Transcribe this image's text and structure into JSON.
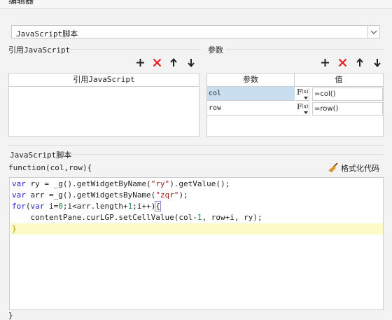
{
  "window": {
    "title": "编辑器"
  },
  "script_type": {
    "selected": "JavaScript脚本"
  },
  "ref_section": {
    "label": "引用JavaScript",
    "column_header": "引用JavaScript"
  },
  "params_section": {
    "label": "参数",
    "headers": [
      "参数",
      "值"
    ],
    "rows": [
      {
        "name": "col",
        "f_label": "F",
        "f_sub": "(x)",
        "value": "=col()"
      },
      {
        "name": "row",
        "f_label": "F",
        "f_sub": "(x)",
        "value": "=row()"
      }
    ]
  },
  "toolbar": {
    "add": "+",
    "delete": "✕",
    "up": "↑",
    "down": "↓"
  },
  "script_section": {
    "label": "JavaScript脚本",
    "signature": "function(col,row){",
    "format_button": "格式化代码",
    "closing": "}"
  },
  "code": {
    "line1": {
      "kw": "var",
      "a": " ry = _g().getWidgetByName(",
      "s": "\"ry\"",
      "b": ").getValue();"
    },
    "line2": {
      "kw": "var",
      "a": " arr =_g().getWidgetsByName(",
      "s": "\"zqr\"",
      "b": ");"
    },
    "line3": {
      "kw1": "for",
      "p1": "(",
      "kw2": "var",
      "a": " i=",
      "n1": "0",
      "b": ";i<arr.length+",
      "n2": "1",
      "c": ";i++)",
      "brace": "{"
    },
    "line4": {
      "a": "    contentPane.curLGP.setCellValue(col-",
      "n1": "1",
      "b": ", row+i, ry);"
    },
    "line5": {
      "brace": "}"
    }
  },
  "colors": {
    "keyword": "#1e1ed6",
    "string": "#a31515",
    "number": "#1b8f4a",
    "delete": "#e02020",
    "selected_row": "#c9dff0",
    "current_line": "#fdfac8"
  }
}
